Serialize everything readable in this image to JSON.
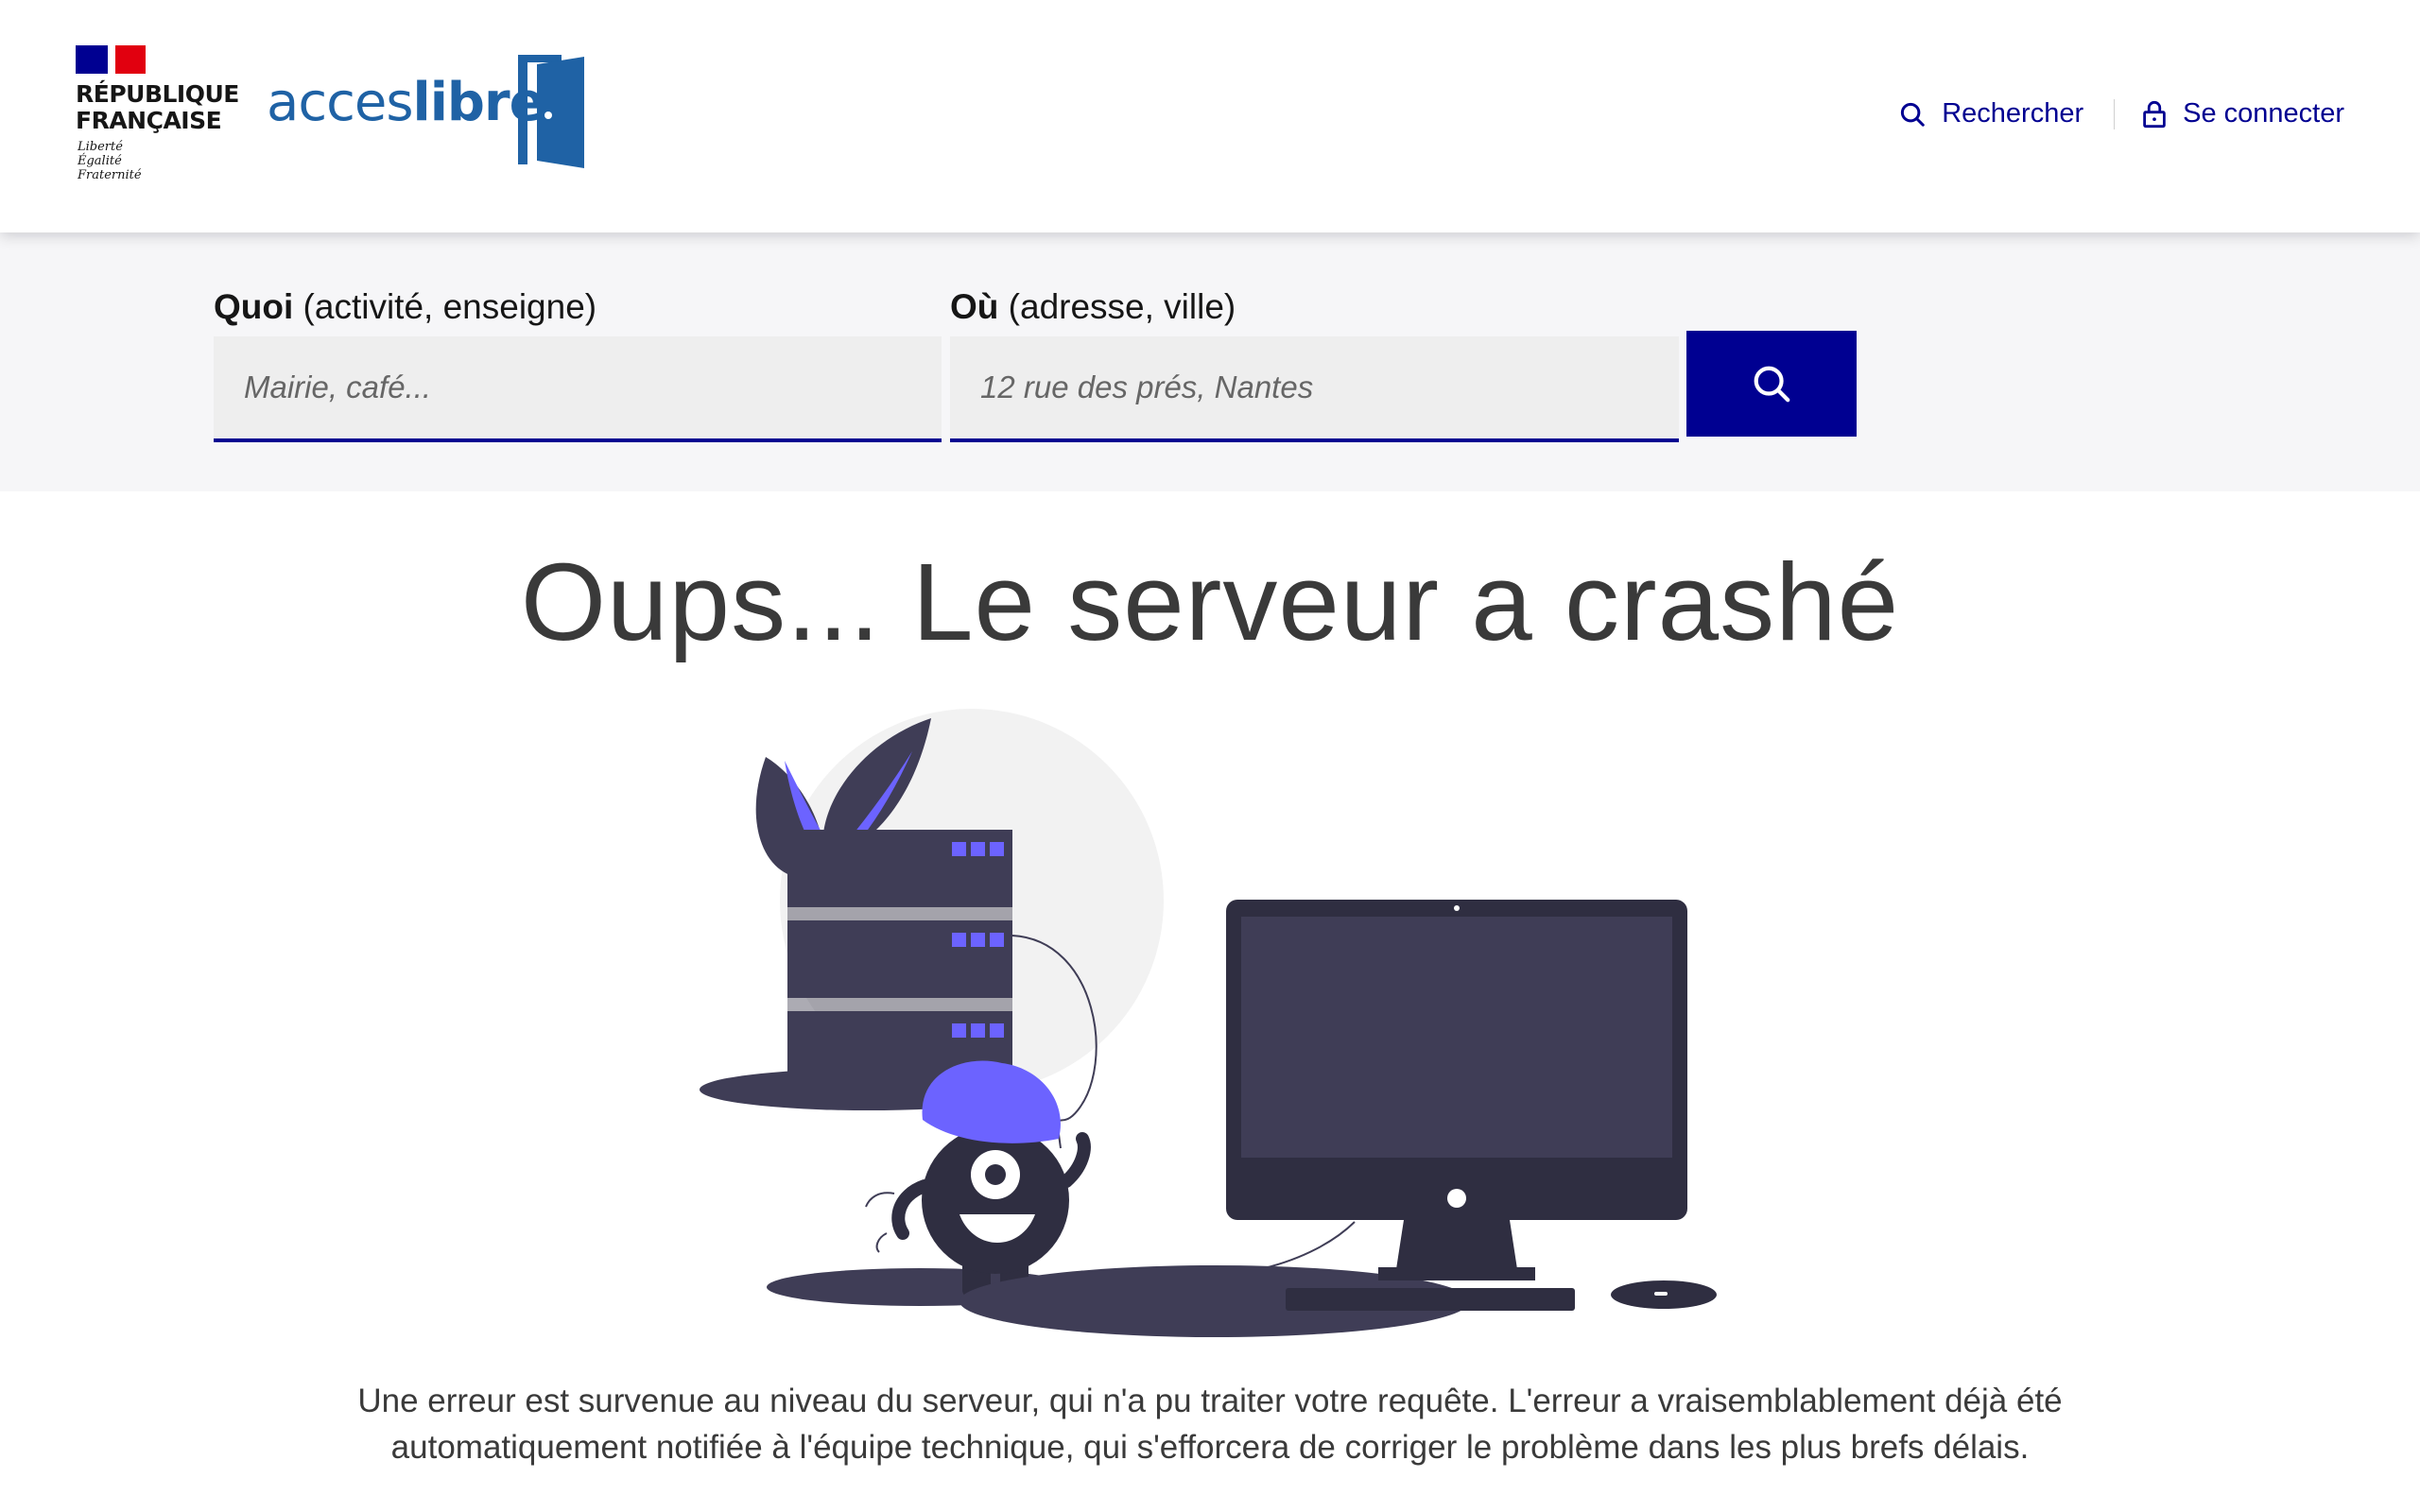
{
  "header": {
    "gov": {
      "line1": "RÉPUBLIQUE",
      "line2": "FRANÇAISE",
      "motto": [
        "Liberté",
        "Égalité",
        "Fraternité"
      ]
    },
    "brand": {
      "part1": "acces",
      "part2": "libre",
      "color": "#1f62a5"
    },
    "nav": {
      "search_label": "Rechercher",
      "login_label": "Se connecter",
      "search_icon": "search-icon",
      "login_icon": "lock-icon"
    }
  },
  "search": {
    "what": {
      "label_bold": "Quoi",
      "label_rest": " (activité, enseigne)",
      "placeholder": "Mairie, café...",
      "value": ""
    },
    "where": {
      "label_bold": "Où",
      "label_rest": " (adresse, ville)",
      "placeholder": "12 rue des prés, Nantes",
      "value": ""
    },
    "submit_icon": "search-icon"
  },
  "main": {
    "title": "Oups... Le serveur a crashé",
    "message": "Une erreur est survenue au niveau du serveur, qui n'a pu traiter votre requête. L'erreur a vraisemblablement déjà été automatiquement notifiée à l'équipe technique, qui s'efforcera de corriger le problème dans les plus brefs délais."
  },
  "colors": {
    "primary": "#000091",
    "brand_blue": "#1f62a5",
    "illustration_dark": "#3f3d56",
    "illustration_accent": "#6c63ff",
    "band_bg": "#f6f6f8"
  }
}
